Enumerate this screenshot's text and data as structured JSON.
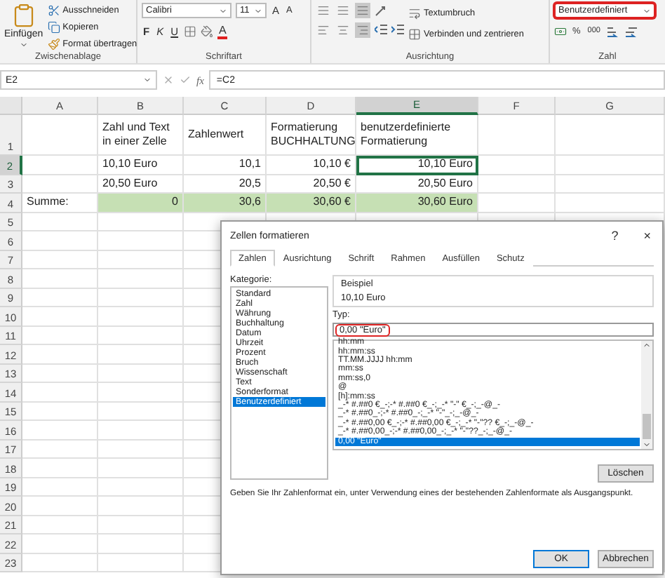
{
  "ribbon": {
    "clipboard": {
      "label": "Zwischenablage",
      "paste": "Einfügen",
      "actions": [
        {
          "kind": "cut",
          "label": "Ausschneiden"
        },
        {
          "kind": "copy",
          "label": "Kopieren"
        },
        {
          "kind": "painter",
          "label": "Format übertragen"
        }
      ]
    },
    "font": {
      "label": "Schriftart",
      "name": "Calibri",
      "size": "11",
      "grow": "A",
      "shrink": "A",
      "bold": "F",
      "italic": "K",
      "underline": "U",
      "color_letter": "A"
    },
    "alignment": {
      "label": "Ausrichtung",
      "wrap": "Textumbruch",
      "merge": "Verbinden und zentrieren"
    },
    "number": {
      "label": "Zahl",
      "format": "Benutzerdefiniert",
      "highlighted": true,
      "percent": "%",
      "thousands": "000"
    }
  },
  "formula_bar": {
    "name_box": "E2",
    "fx": "fx",
    "formula": "=C2"
  },
  "sheet": {
    "columns": [
      {
        "label": "A",
        "selected": false
      },
      {
        "label": "B",
        "selected": false
      },
      {
        "label": "C",
        "selected": false
      },
      {
        "label": "D",
        "selected": false
      },
      {
        "label": "E",
        "selected": true
      },
      {
        "label": "F",
        "selected": false
      },
      {
        "label": "G",
        "selected": false
      }
    ],
    "rows": [
      {
        "label": "1",
        "selected": false,
        "cells": [
          {
            "text": ""
          },
          {
            "text": "Zahl und Text\nin einer Zelle",
            "right_aligned": false
          },
          {
            "text": "Zahlenwert",
            "right_aligned": false
          },
          {
            "text": "Formatierung\nBUCHHALTUNG",
            "right_aligned": false
          },
          {
            "text": "benutzerdefinierte\nFormatierung",
            "right_aligned": false
          }
        ]
      },
      {
        "label": "2",
        "selected": true,
        "cells": [
          {
            "text": ""
          },
          {
            "text": "10,10 Euro",
            "right_aligned": false
          },
          {
            "text": "10,1",
            "right_aligned": true
          },
          {
            "text": "10,10 €",
            "right_aligned": true
          },
          {
            "text": "10,10 Euro",
            "right_aligned": true,
            "selected": true
          }
        ]
      },
      {
        "label": "3",
        "selected": false,
        "cells": [
          {
            "text": ""
          },
          {
            "text": "20,50 Euro",
            "right_aligned": false
          },
          {
            "text": "20,5",
            "right_aligned": true
          },
          {
            "text": "20,50 €",
            "right_aligned": true
          },
          {
            "text": "20,50 Euro",
            "right_aligned": true
          }
        ]
      },
      {
        "label": "4",
        "selected": false,
        "cells": [
          {
            "text": "Summe:",
            "right_aligned": false
          },
          {
            "text": "0",
            "right_aligned": true,
            "shaded": true
          },
          {
            "text": "30,6",
            "right_aligned": true,
            "shaded": true
          },
          {
            "text": "30,60 €",
            "right_aligned": true,
            "shaded": true
          },
          {
            "text": "30,60 Euro",
            "right_aligned": true,
            "shaded": true
          }
        ]
      },
      {
        "label": "5",
        "selected": false
      },
      {
        "label": "6",
        "selected": false
      },
      {
        "label": "7",
        "selected": false
      },
      {
        "label": "8",
        "selected": false
      },
      {
        "label": "9",
        "selected": false
      },
      {
        "label": "10",
        "selected": false
      },
      {
        "label": "11",
        "selected": false
      },
      {
        "label": "12",
        "selected": false
      },
      {
        "label": "13",
        "selected": false
      },
      {
        "label": "14",
        "selected": false
      },
      {
        "label": "15",
        "selected": false
      },
      {
        "label": "16",
        "selected": false
      },
      {
        "label": "17",
        "selected": false
      },
      {
        "label": "18",
        "selected": false
      },
      {
        "label": "19",
        "selected": false
      },
      {
        "label": "20",
        "selected": false
      },
      {
        "label": "21",
        "selected": false
      },
      {
        "label": "22",
        "selected": false
      },
      {
        "label": "23",
        "selected": false
      }
    ]
  },
  "dialog": {
    "title": "Zellen formatieren",
    "help": "?",
    "close": "×",
    "tabs": [
      {
        "label": "Zahlen",
        "selected": true
      },
      {
        "label": "Ausrichtung",
        "selected": false
      },
      {
        "label": "Schrift",
        "selected": false
      },
      {
        "label": "Rahmen",
        "selected": false
      },
      {
        "label": "Ausfüllen",
        "selected": false
      },
      {
        "label": "Schutz",
        "selected": false
      }
    ],
    "category_label": "Kategorie:",
    "categories": [
      {
        "label": "Standard",
        "selected": false
      },
      {
        "label": "Zahl",
        "selected": false
      },
      {
        "label": "Währung",
        "selected": false
      },
      {
        "label": "Buchhaltung",
        "selected": false
      },
      {
        "label": "Datum",
        "selected": false
      },
      {
        "label": "Uhrzeit",
        "selected": false
      },
      {
        "label": "Prozent",
        "selected": false
      },
      {
        "label": "Bruch",
        "selected": false
      },
      {
        "label": "Wissenschaft",
        "selected": false
      },
      {
        "label": "Text",
        "selected": false
      },
      {
        "label": "Sonderformat",
        "selected": false
      },
      {
        "label": "Benutzerdefiniert",
        "selected": true
      }
    ],
    "sample_label": "Beispiel",
    "sample": "10,10 Euro",
    "type_label": "Typ:",
    "type_value": "0,00 \"Euro\"",
    "type_highlighted": true,
    "formats": [
      {
        "label": "hh:mm",
        "selected": false
      },
      {
        "label": "hh:mm:ss",
        "selected": false
      },
      {
        "label": "TT.MM.JJJJ hh:mm",
        "selected": false
      },
      {
        "label": "mm:ss",
        "selected": false
      },
      {
        "label": "mm:ss,0",
        "selected": false
      },
      {
        "label": "@",
        "selected": false
      },
      {
        "label": "[h]:mm:ss",
        "selected": false
      },
      {
        "label": "_-* #.##0 €_-;-* #.##0 €_-;_-* \"-\" €_-;_-@_-",
        "selected": false
      },
      {
        "label": "_-* #.##0_-;-* #.##0_-;_-* \"-\"_-;_-@_-",
        "selected": false
      },
      {
        "label": "_-* #.##0,00 €_-;-* #.##0,00 €_-;_-* \"-\"?? €_-;_-@_-",
        "selected": false
      },
      {
        "label": "_-* #.##0,00_-;-* #.##0,00_-;_-* \"-\"??_-;_-@_-",
        "selected": false
      },
      {
        "label": "0,00 \"Euro\"",
        "selected": true
      }
    ],
    "delete": "Löschen",
    "hint": "Geben Sie Ihr Zahlenformat ein, unter Verwendung eines der bestehenden Zahlenformate als Ausgangspunkt.",
    "ok": "OK",
    "cancel": "Abbrechen"
  }
}
